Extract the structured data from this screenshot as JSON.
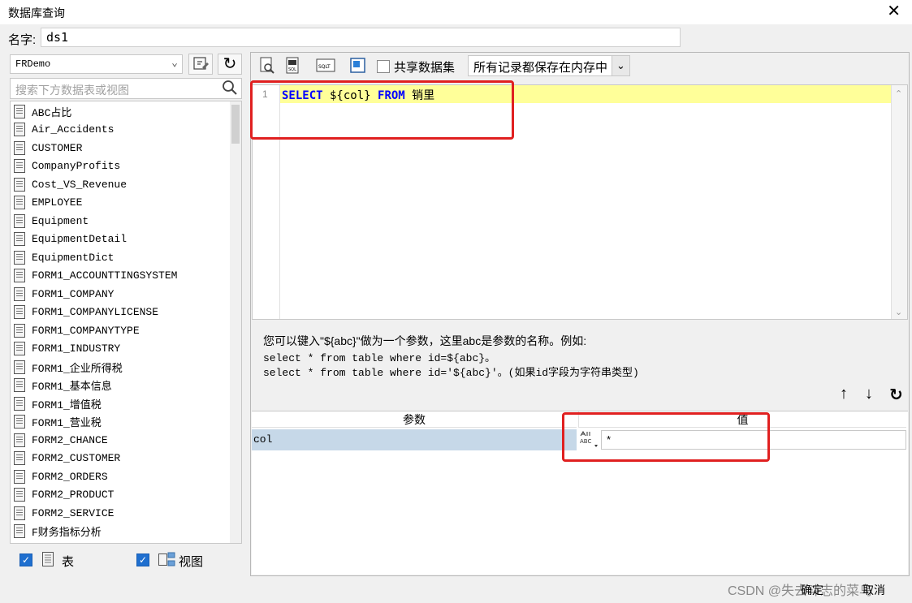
{
  "window": {
    "title": "数据库查询",
    "close_glyph": "✕"
  },
  "name_row": {
    "label": "名字:",
    "value": "ds1"
  },
  "left": {
    "db_select": "FRDemo",
    "search_placeholder": "搜索下方数据表或视图",
    "tables": [
      "ABC占比",
      "Air_Accidents",
      "CUSTOMER",
      "CompanyProfits",
      "Cost_VS_Revenue",
      "EMPLOYEE",
      "Equipment",
      "EquipmentDetail",
      "EquipmentDict",
      "FORM1_ACCOUNTTINGSYSTEM",
      "FORM1_COMPANY",
      "FORM1_COMPANYLICENSE",
      "FORM1_COMPANYTYPE",
      "FORM1_INDUSTRY",
      "FORM1_企业所得税",
      "FORM1_基本信息",
      "FORM1_增值税",
      "FORM1_营业税",
      "FORM2_CHANCE",
      "FORM2_CUSTOMER",
      "FORM2_ORDERS",
      "FORM2_PRODUCT",
      "FORM2_SERVICE",
      "F财务指标分析"
    ],
    "filter_table_label": "表",
    "filter_view_label": "视图"
  },
  "toolbar": {
    "share_label": "共享数据集",
    "memory_select": "所有记录都保存在内存中",
    "sql_icon_text": "SQLT"
  },
  "editor": {
    "line_number": "1",
    "sql": {
      "kw1": "SELECT",
      "mid": " ${col} ",
      "kw2": "FROM",
      "tail": " 销里"
    }
  },
  "hints": {
    "line1": "您可以键入\"${abc}\"做为一个参数，这里abc是参数的名称。例如:",
    "line2": "select * from table where id=${abc}。",
    "line3": "select * from table where id='${abc}'。(如果id字段为字符串类型)"
  },
  "params": {
    "header_param": "参数",
    "header_value": "值",
    "rows": [
      {
        "name": "col",
        "value": "*",
        "type_icon_text": "ABC"
      }
    ]
  },
  "footer": {
    "ok": "确定",
    "cancel": "取消"
  },
  "watermark": "CSDN @失去斗志的菜鸟",
  "colors": {
    "accent": "#1f6fcf",
    "highlight_line": "#ffff99",
    "keyword": "#0000ff",
    "annotation": "#e02020",
    "selected_row": "#c6d8e8"
  }
}
